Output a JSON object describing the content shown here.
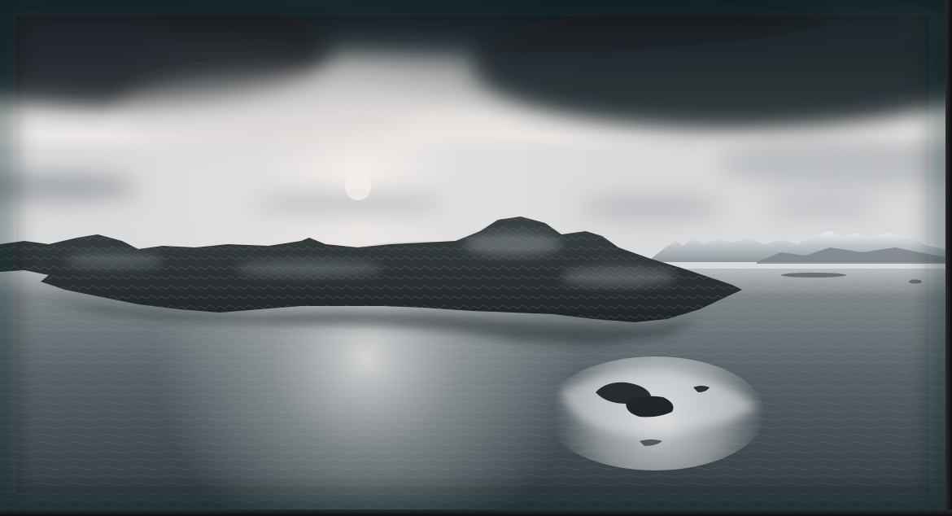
{
  "scene": {
    "subject": "",
    "palette": {
      "sky_dark": "#1f282c",
      "sky_light": "#e7e4e2",
      "haze": "#d6d7d9",
      "water_dark": "#2f383d",
      "water_light": "#c9cbcd",
      "rock": "#2b3134",
      "snow": "#dfe2e6"
    }
  }
}
